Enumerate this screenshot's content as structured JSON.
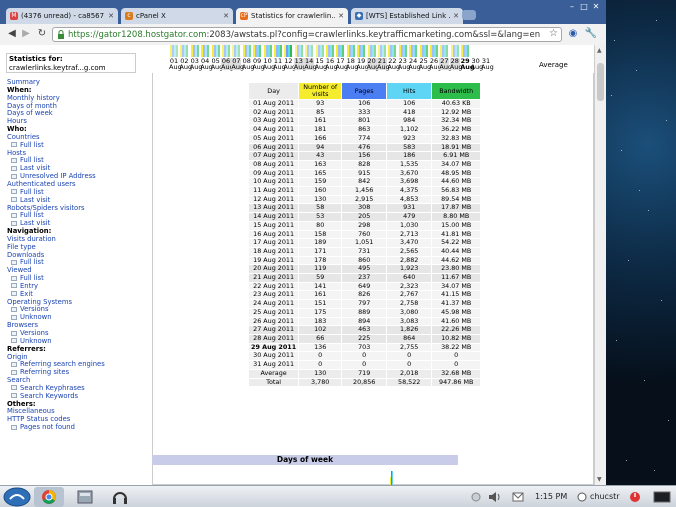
{
  "tabs": [
    {
      "label": "(4376 unread) - ca8567 …",
      "icon": "gmail-icon",
      "active": false
    },
    {
      "label": "cPanel X",
      "icon": "cpanel-icon",
      "active": false
    },
    {
      "label": "Statistics for crawlerlin…",
      "icon": "cp-icon",
      "active": true
    },
    {
      "label": "[WTS] Established Link …",
      "icon": "forum-icon",
      "active": false
    }
  ],
  "address": {
    "secure": "https://gator1208.hostgator.com",
    "rest": ":2083/awstats.pl?config=crawlerlinks.keytrafficmarketing.com&ssl=&lang=en"
  },
  "stats_for": {
    "label": "Statistics for:",
    "site": "crawlerlinks.keytraf...g.com"
  },
  "nav": [
    {
      "t": "Summary",
      "k": "link"
    },
    {
      "t": "When:",
      "k": "head"
    },
    {
      "t": "Monthly history",
      "k": "link"
    },
    {
      "t": "Days of month",
      "k": "link"
    },
    {
      "t": "Days of week",
      "k": "link"
    },
    {
      "t": "Hours",
      "k": "link"
    },
    {
      "t": "Who:",
      "k": "head"
    },
    {
      "t": "Countries",
      "k": "link"
    },
    {
      "t": "Full list",
      "k": "sub"
    },
    {
      "t": "Hosts",
      "k": "link"
    },
    {
      "t": "Full list",
      "k": "sub"
    },
    {
      "t": "Last visit",
      "k": "sub"
    },
    {
      "t": "Unresolved IP Address",
      "k": "sub"
    },
    {
      "t": "Authenticated users",
      "k": "link"
    },
    {
      "t": "Full list",
      "k": "sub"
    },
    {
      "t": "Last visit",
      "k": "sub"
    },
    {
      "t": "Robots/Spiders visitors",
      "k": "link"
    },
    {
      "t": "Full list",
      "k": "sub"
    },
    {
      "t": "Last visit",
      "k": "sub"
    },
    {
      "t": "Navigation:",
      "k": "head"
    },
    {
      "t": "Visits duration",
      "k": "link"
    },
    {
      "t": "File type",
      "k": "link"
    },
    {
      "t": "Downloads",
      "k": "link"
    },
    {
      "t": "Full list",
      "k": "sub"
    },
    {
      "t": "Viewed",
      "k": "link"
    },
    {
      "t": "Full list",
      "k": "sub"
    },
    {
      "t": "Entry",
      "k": "sub"
    },
    {
      "t": "Exit",
      "k": "sub"
    },
    {
      "t": "Operating Systems",
      "k": "link"
    },
    {
      "t": "Versions",
      "k": "sub"
    },
    {
      "t": "Unknown",
      "k": "sub"
    },
    {
      "t": "Browsers",
      "k": "link"
    },
    {
      "t": "Versions",
      "k": "sub"
    },
    {
      "t": "Unknown",
      "k": "sub"
    },
    {
      "t": "Referrers:",
      "k": "head"
    },
    {
      "t": "Origin",
      "k": "link"
    },
    {
      "t": "Referring search engines",
      "k": "sub"
    },
    {
      "t": "Referring sites",
      "k": "sub"
    },
    {
      "t": "Search",
      "k": "link"
    },
    {
      "t": "Search Keyphrases",
      "k": "sub"
    },
    {
      "t": "Search Keywords",
      "k": "sub"
    },
    {
      "t": "Others:",
      "k": "head"
    },
    {
      "t": "Miscellaneous",
      "k": "link"
    },
    {
      "t": "HTTP Status codes",
      "k": "link"
    },
    {
      "t": "Pages not found",
      "k": "sub"
    }
  ],
  "day_strip": {
    "days": [
      "01",
      "02",
      "03",
      "04",
      "05",
      "06",
      "07",
      "08",
      "09",
      "10",
      "11",
      "12",
      "13",
      "14",
      "15",
      "16",
      "17",
      "18",
      "19",
      "20",
      "21",
      "22",
      "23",
      "24",
      "25",
      "26",
      "27",
      "28",
      "29",
      "30",
      "31"
    ],
    "month": "Aug",
    "average_label": "Average"
  },
  "colors": {
    "visits": "#f4ec2c",
    "pages": "#4b7df3",
    "hits": "#5fd5f5",
    "bandwidth": "#2cbd4a"
  },
  "table": {
    "headers": [
      "Day",
      "Number of visits",
      "Pages",
      "Hits",
      "Bandwidth"
    ],
    "rows": [
      [
        "01 Aug 2011",
        "93",
        "106",
        "106",
        "40.63 KB"
      ],
      [
        "02 Aug 2011",
        "85",
        "333",
        "418",
        "12.92 MB"
      ],
      [
        "03 Aug 2011",
        "161",
        "801",
        "984",
        "32.34 MB"
      ],
      [
        "04 Aug 2011",
        "181",
        "863",
        "1,102",
        "36.22 MB"
      ],
      [
        "05 Aug 2011",
        "166",
        "774",
        "923",
        "32.83 MB"
      ],
      [
        "06 Aug 2011",
        "94",
        "476",
        "583",
        "18.91 MB"
      ],
      [
        "07 Aug 2011",
        "43",
        "156",
        "186",
        "6.91 MB"
      ],
      [
        "08 Aug 2011",
        "163",
        "828",
        "1,535",
        "34.07 MB"
      ],
      [
        "09 Aug 2011",
        "165",
        "915",
        "3,670",
        "48.95 MB"
      ],
      [
        "10 Aug 2011",
        "159",
        "842",
        "3,698",
        "44.60 MB"
      ],
      [
        "11 Aug 2011",
        "160",
        "1,456",
        "4,375",
        "56.83 MB"
      ],
      [
        "12 Aug 2011",
        "130",
        "2,915",
        "4,853",
        "89.54 MB"
      ],
      [
        "13 Aug 2011",
        "58",
        "308",
        "931",
        "17.87 MB"
      ],
      [
        "14 Aug 2011",
        "53",
        "205",
        "479",
        "8.80 MB"
      ],
      [
        "15 Aug 2011",
        "80",
        "298",
        "1,030",
        "15.00 MB"
      ],
      [
        "16 Aug 2011",
        "158",
        "760",
        "2,713",
        "41.81 MB"
      ],
      [
        "17 Aug 2011",
        "189",
        "1,051",
        "3,470",
        "54.22 MB"
      ],
      [
        "18 Aug 2011",
        "171",
        "731",
        "2,565",
        "40.44 MB"
      ],
      [
        "19 Aug 2011",
        "178",
        "860",
        "2,882",
        "44.62 MB"
      ],
      [
        "20 Aug 2011",
        "119",
        "495",
        "1,923",
        "23.80 MB"
      ],
      [
        "21 Aug 2011",
        "59",
        "237",
        "640",
        "11.67 MB"
      ],
      [
        "22 Aug 2011",
        "141",
        "649",
        "2,323",
        "34.07 MB"
      ],
      [
        "23 Aug 2011",
        "161",
        "826",
        "2,767",
        "41.15 MB"
      ],
      [
        "24 Aug 2011",
        "151",
        "797",
        "2,758",
        "41.37 MB"
      ],
      [
        "25 Aug 2011",
        "175",
        "889",
        "3,080",
        "45.98 MB"
      ],
      [
        "26 Aug 2011",
        "183",
        "894",
        "3,083",
        "41.60 MB"
      ],
      [
        "27 Aug 2011",
        "102",
        "463",
        "1,826",
        "22.26 MB"
      ],
      [
        "28 Aug 2011",
        "66",
        "225",
        "864",
        "10.82 MB"
      ],
      [
        "29 Aug 2011",
        "136",
        "703",
        "2,755",
        "38.22 MB"
      ],
      [
        "30 Aug 2011",
        "0",
        "0",
        "0",
        "0"
      ],
      [
        "31 Aug 2011",
        "0",
        "0",
        "0",
        "0"
      ]
    ],
    "average": [
      "Average",
      "130",
      "719",
      "2,018",
      "32.68 MB"
    ],
    "total": [
      "Total",
      "3,780",
      "20,856",
      "58,522",
      "947.86 MB"
    ]
  },
  "days_of_week_title": "Days of week",
  "taskbar": {
    "time": "1:15 PM",
    "user": "chucstr"
  }
}
